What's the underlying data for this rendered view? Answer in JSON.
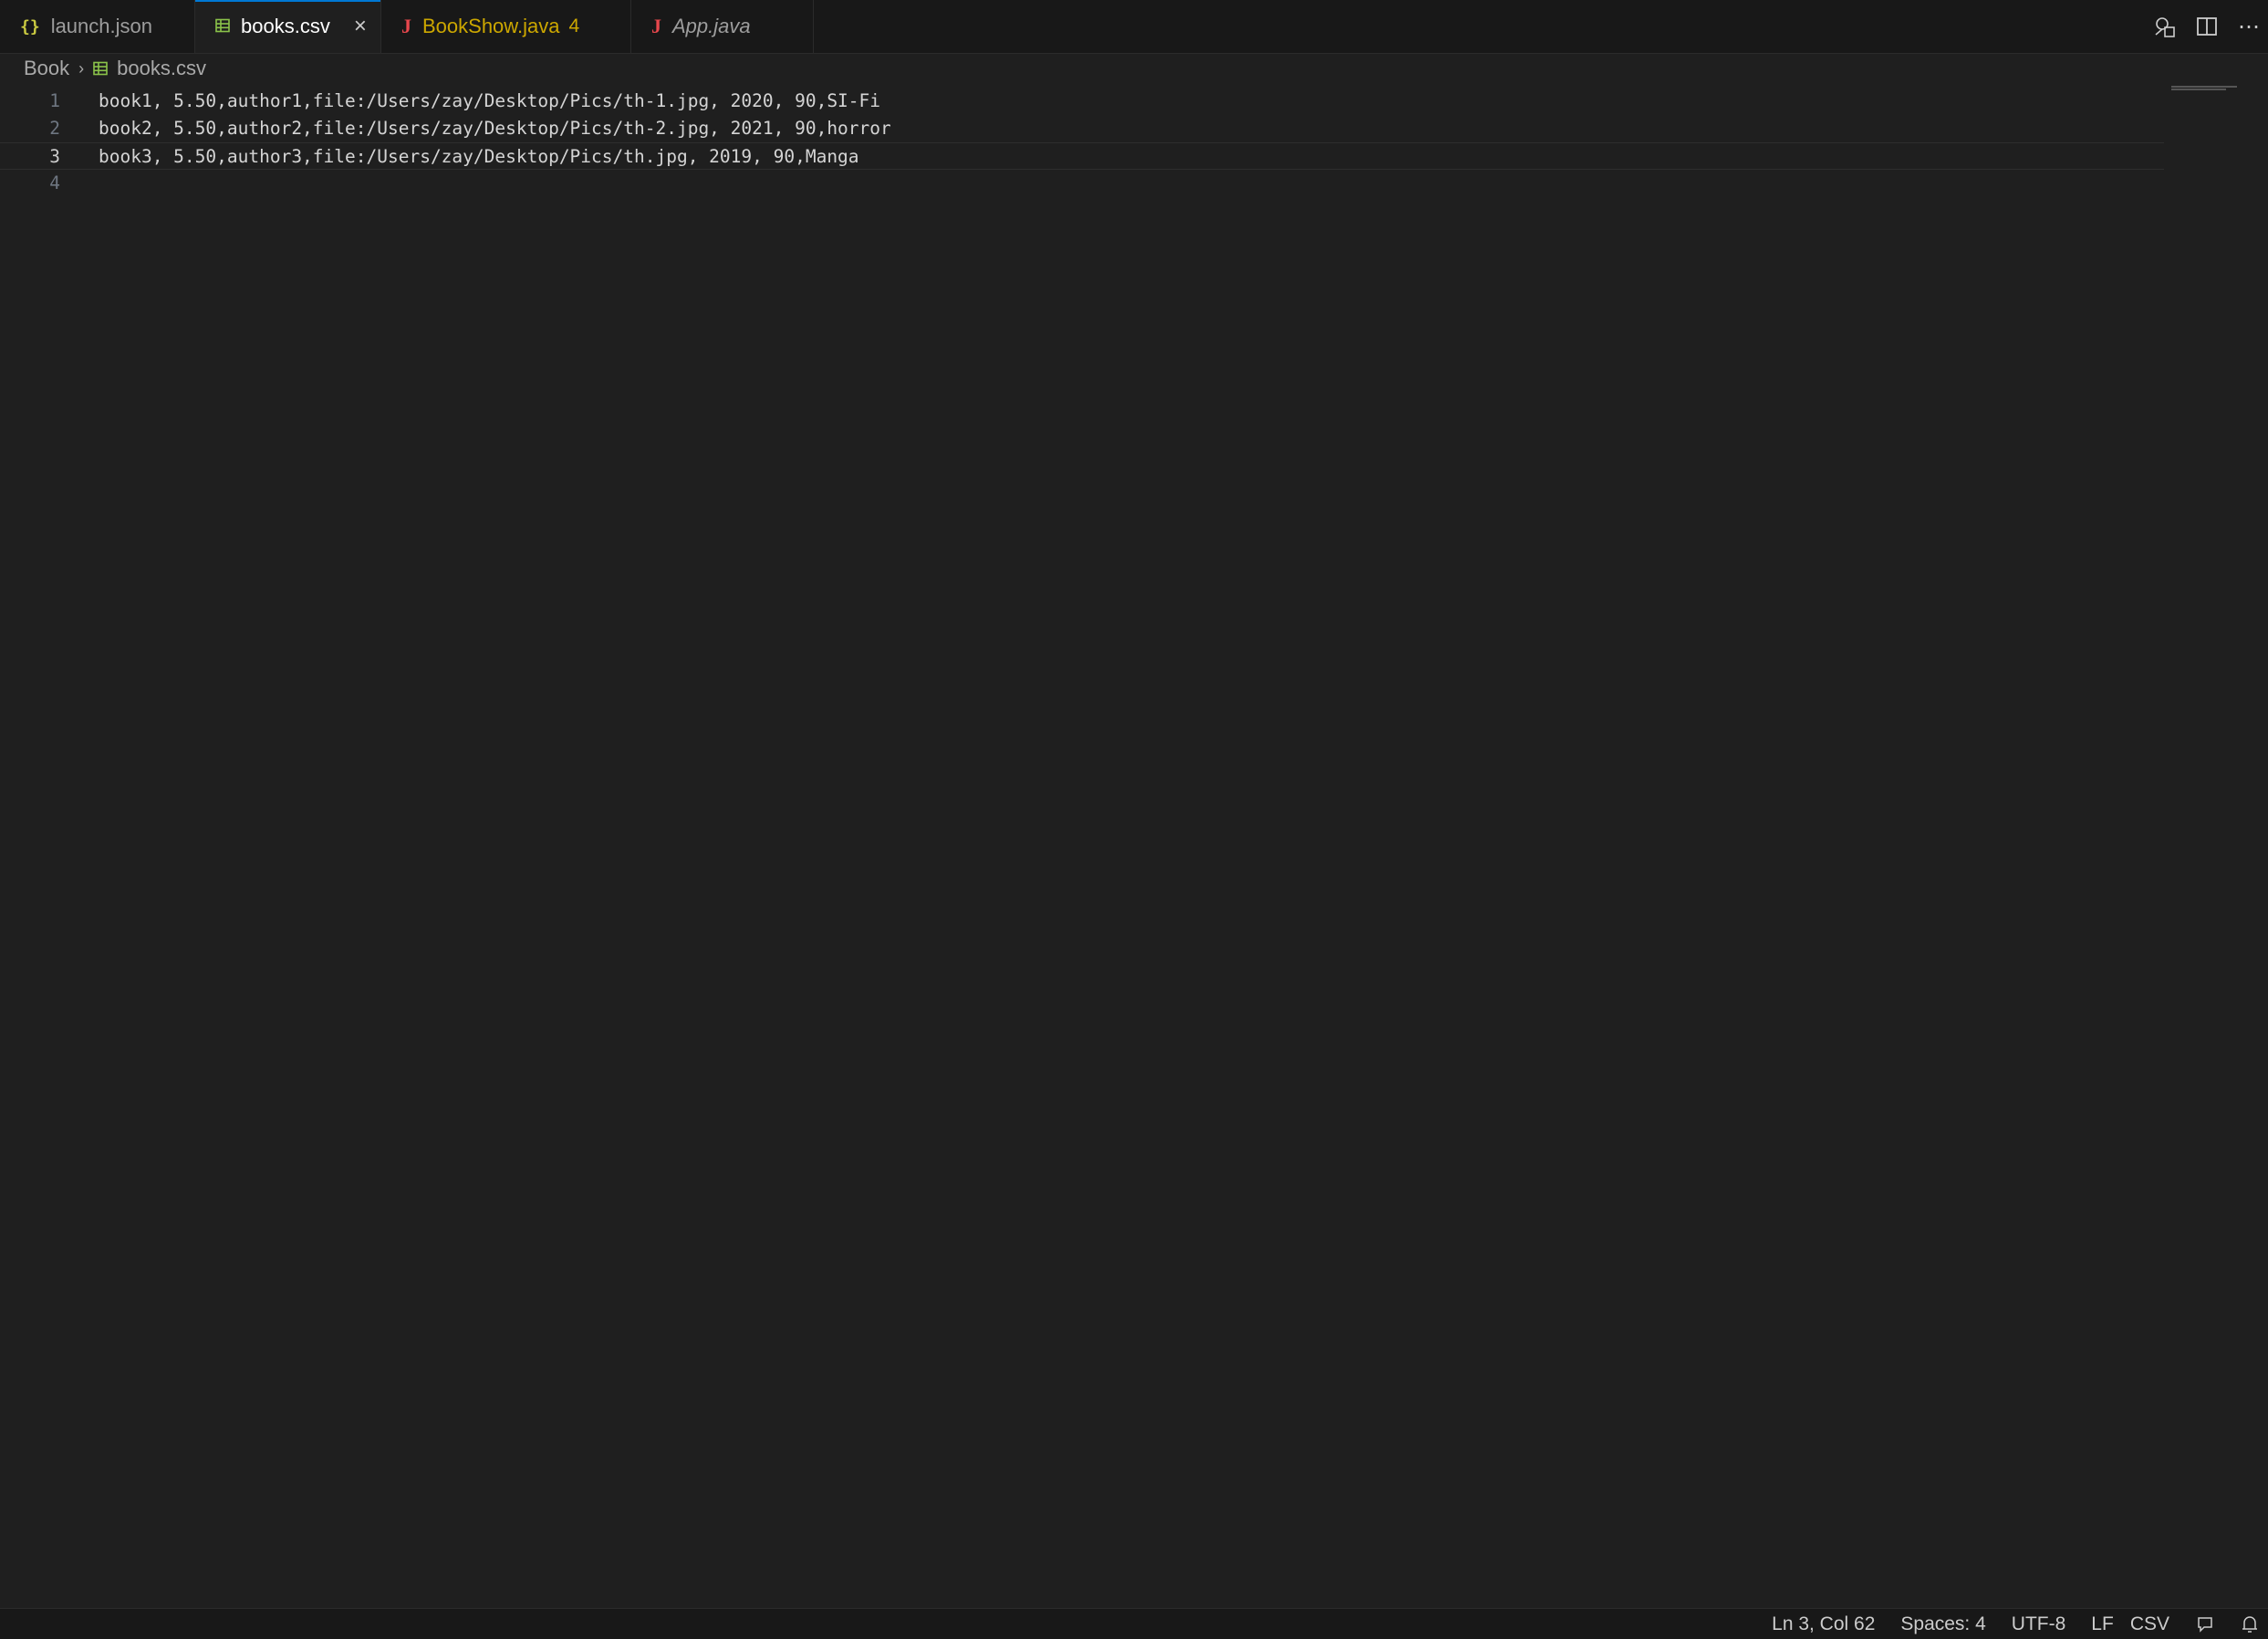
{
  "tabs": [
    {
      "label": "launch.json",
      "icon": "json-icon",
      "active": false
    },
    {
      "label": "books.csv",
      "icon": "csv-table-icon",
      "active": true
    },
    {
      "label": "BookShow.java",
      "icon": "java-icon",
      "badge": "4",
      "active": false
    },
    {
      "label": "App.java",
      "icon": "java-icon",
      "active": false
    }
  ],
  "breadcrumb": {
    "folder": "Book",
    "file": "books.csv"
  },
  "editor": {
    "lines": [
      {
        "number": "1",
        "text": "book1, 5.50,author1,file:/Users/zay/Desktop/Pics/th-1.jpg, 2020, 90,SI-Fi"
      },
      {
        "number": "2",
        "text": "book2, 5.50,author2,file:/Users/zay/Desktop/Pics/th-2.jpg, 2021, 90,horror"
      },
      {
        "number": "3",
        "text": "book3, 5.50,author3,file:/Users/zay/Desktop/Pics/th.jpg, 2019, 90,Manga"
      },
      {
        "number": "4",
        "text": ""
      }
    ]
  },
  "statusbar": {
    "position": "Ln 3, Col 62",
    "spaces": "Spaces: 4",
    "encoding": "UTF-8",
    "eol": "LF",
    "language": "CSV"
  },
  "colors": {
    "editor_bg": "#1f1f1f",
    "tab_bg": "#181818",
    "active_tab_accent": "#0078d4",
    "warning": "#cca700",
    "java_icon": "#e8474d",
    "csv_icon": "#8bc34a",
    "json_icon": "#cbcb41"
  }
}
